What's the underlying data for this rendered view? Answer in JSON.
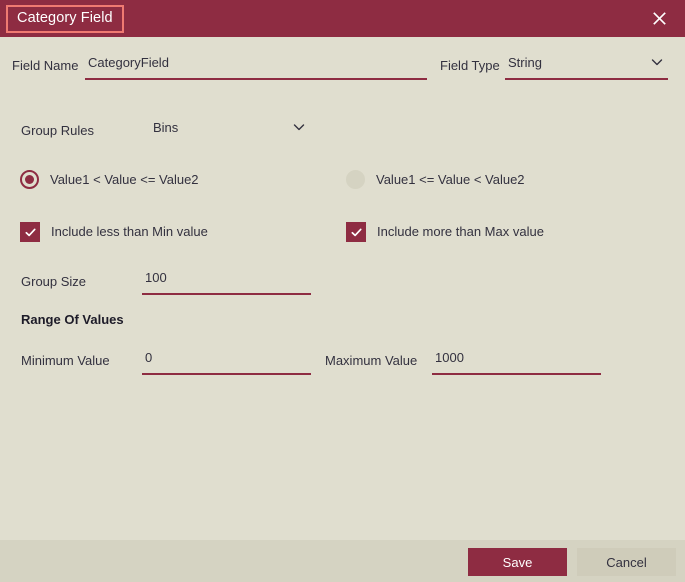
{
  "titlebar": {
    "title": "Category Field",
    "close_icon": "close-icon"
  },
  "form": {
    "field_name": {
      "label": "Field Name",
      "value": "CategoryField",
      "placeholder": "Field Name"
    },
    "field_type": {
      "label": "Field Type",
      "value": "String",
      "chevron_icon": "chevron-down-icon"
    },
    "group_rules": {
      "label": "Group Rules",
      "value": "Bins",
      "chevron_icon": "chevron-down-icon"
    },
    "interval_radio": {
      "option_left": "Value1 < Value <= Value2",
      "option_right": "Value1 <= Value < Value2",
      "selected": "option_left"
    },
    "include_min": {
      "label": "Include less than Min value",
      "checked": true,
      "check_icon": "check-icon"
    },
    "include_max": {
      "label": "Include more than Max value",
      "checked": true,
      "check_icon": "check-icon"
    },
    "group_size": {
      "label": "Group Size",
      "value": "100",
      "placeholder": "Group Size"
    },
    "range_heading": "Range Of Values",
    "minimum_value": {
      "label": "Minimum Value",
      "value": "0",
      "placeholder": "Minimum Value"
    },
    "maximum_value": {
      "label": "Maximum Value",
      "value": "1000",
      "placeholder": "Maximum Value"
    }
  },
  "footer": {
    "save_label": "Save",
    "cancel_label": "Cancel"
  },
  "colors": {
    "accent": "#8e2c42",
    "background": "#e0decf",
    "footer_background": "#d5d3c2",
    "title_focus_border": "#f07a72",
    "cancel_button": "#cfccba"
  }
}
